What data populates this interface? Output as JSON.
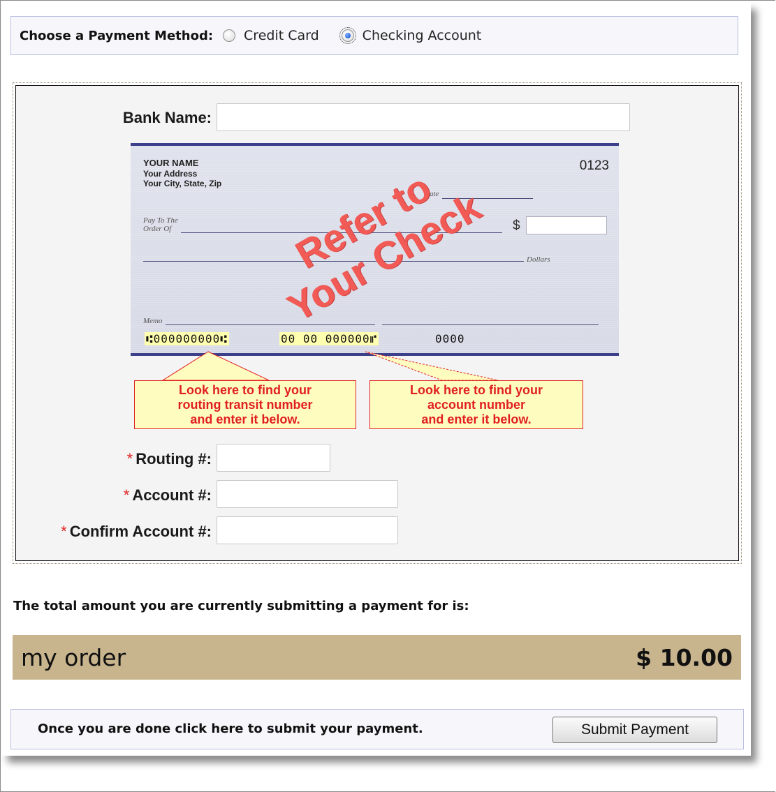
{
  "payment_method": {
    "label": "Choose a Payment Method:",
    "options": [
      {
        "label": "Credit Card",
        "selected": false
      },
      {
        "label": "Checking Account",
        "selected": true
      }
    ]
  },
  "bank_form": {
    "bank_name_label": "Bank Name:",
    "bank_name_value": "",
    "routing_label": "Routing #:",
    "routing_value": "",
    "account_label": "Account #:",
    "account_value": "",
    "confirm_account_label": "Confirm Account #:",
    "confirm_account_value": "",
    "required_marker": "*"
  },
  "check_image": {
    "name": "YOUR NAME",
    "address": "Your Address",
    "city": "Your City, State, Zip",
    "check_number": "0123",
    "date_label": "Date",
    "pay_to_line1": "Pay To The",
    "pay_to_line2": "Order Of",
    "dollar_sign": "$",
    "dollars_label": "Dollars",
    "memo_label": "Memo",
    "routing_micr": "⑆000000000⑆",
    "account_micr": "00 00 000000⑈",
    "check_micr": "0000",
    "stamp_line1": "Refer to",
    "stamp_line2": "Your Check"
  },
  "callouts": {
    "routing": [
      "Look here to find your",
      "routing transit number",
      "and enter it below."
    ],
    "account": [
      "Look here to find your",
      "account number",
      "and enter it below."
    ]
  },
  "total": {
    "text": "The total amount you are currently submitting a payment for is:",
    "order_name": "my order",
    "amount": "$ 10.00"
  },
  "submit": {
    "text": "Once you are done click here to submit your payment.",
    "button_label": "Submit Payment"
  },
  "colors": {
    "order_bar": "#c8b48d",
    "callout_bg": "#fffcc0",
    "callout_text": "#e02020",
    "stamp": "#f25a55"
  }
}
